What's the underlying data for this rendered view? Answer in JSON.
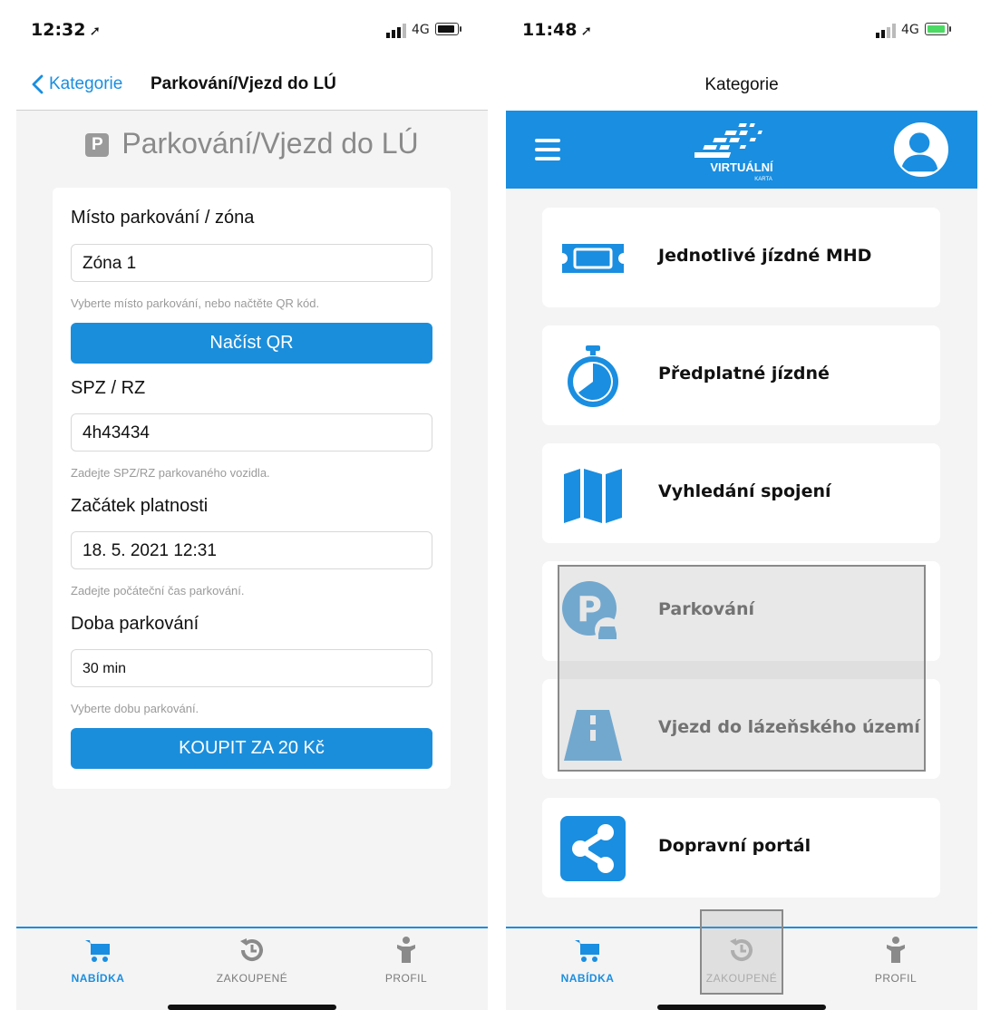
{
  "left": {
    "status": {
      "time": "12:32",
      "network": "4G"
    },
    "nav": {
      "back_label": "Kategorie",
      "title": "Parkování/Vjezd do LÚ"
    },
    "page_heading": "Parkování/Vjezd do LÚ",
    "page_icon_letter": "P",
    "form": {
      "zone_label": "Místo parkování / zóna",
      "zone_value": "Zóna 1",
      "zone_hint": "Vyberte místo parkování, nebo načtěte QR kód.",
      "qr_button": "Načíst QR",
      "plate_label": "SPZ / RZ",
      "plate_value": "4h43434",
      "plate_hint": "Zadejte SPZ/RZ parkovaného vozidla.",
      "start_label": "Začátek platnosti",
      "start_value": "18. 5. 2021  12:31",
      "start_hint": "Zadejte počáteční čas parkování.",
      "duration_label": "Doba parkování",
      "duration_value": "30 min",
      "duration_hint": "Vyberte dobu parkování.",
      "buy_button": "KOUPIT ZA 20 Kč"
    }
  },
  "right": {
    "status": {
      "time": "11:48",
      "network": "4G"
    },
    "title": "Kategorie",
    "logo_text": "VIRTUÁLNÍ",
    "logo_sub": "KARTA",
    "menu": [
      {
        "label": "Jednotlivé jízdné MHD",
        "icon": "ticket-icon"
      },
      {
        "label": "Předplatné jízdné",
        "icon": "stopwatch-icon"
      },
      {
        "label": "Vyhledání spojení",
        "icon": "map-icon"
      },
      {
        "label": "Parkování",
        "icon": "parking-icon"
      },
      {
        "label": "Vjezd do lázeňského území",
        "icon": "road-icon"
      },
      {
        "label": "Dopravní portál",
        "icon": "share-icon"
      }
    ]
  },
  "tabs": [
    {
      "label": "NABÍDKA",
      "icon": "cart-icon",
      "active": true
    },
    {
      "label": "ZAKOUPENÉ",
      "icon": "history-icon",
      "active": false
    },
    {
      "label": "PROFIL",
      "icon": "person-icon",
      "active": false
    }
  ],
  "colors": {
    "accent": "#1a8ee0",
    "background": "#f4f4f4",
    "muted": "#9a9a9a"
  }
}
